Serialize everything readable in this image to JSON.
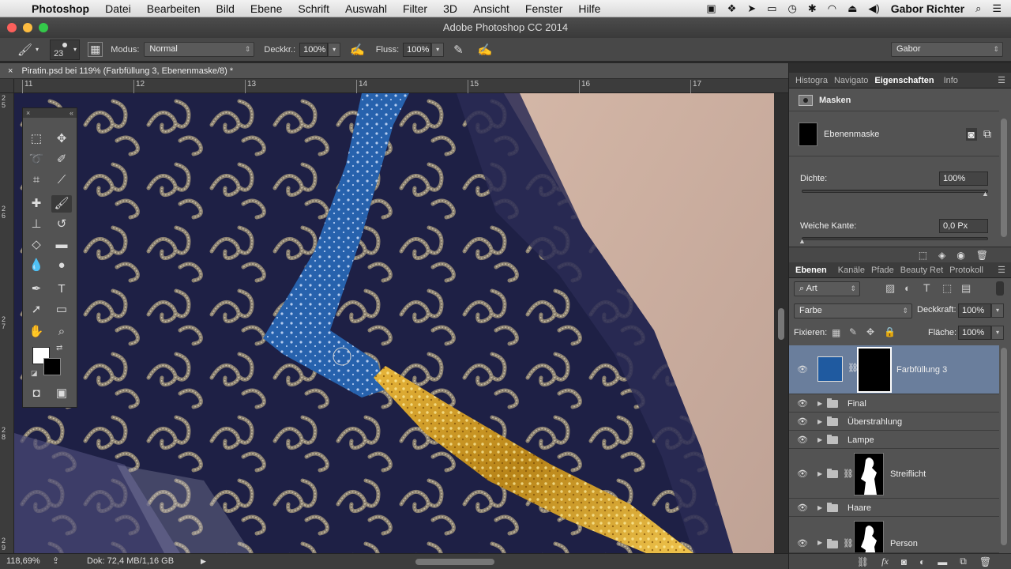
{
  "menubar": {
    "apple": "",
    "app": "Photoshop",
    "items": [
      "Datei",
      "Bearbeiten",
      "Bild",
      "Ebene",
      "Schrift",
      "Auswahl",
      "Filter",
      "3D",
      "Ansicht",
      "Fenster",
      "Hilfe"
    ],
    "user": "Gabor Richter"
  },
  "window": {
    "title": "Adobe Photoshop CC 2014"
  },
  "options": {
    "brush_size": "23",
    "modus_label": "Modus:",
    "modus_value": "Normal",
    "deckkr_label": "Deckkr.:",
    "deckkr_value": "100%",
    "fluss_label": "Fluss:",
    "fluss_value": "100%",
    "workspace": "Gabor"
  },
  "document": {
    "tab_title": "Piratin.psd bei 119% (Farbfüllung 3, Ebenenmaske/8) *",
    "ruler_h": [
      "11",
      "12",
      "13",
      "14",
      "15",
      "16",
      "17"
    ],
    "ruler_v": [
      "2\n5",
      "2\n6",
      "2\n7",
      "2\n8",
      "2\n9"
    ],
    "zoom": "118,69%",
    "doc_info": "Dok: 72,4 MB/1,16 GB"
  },
  "properties_panel": {
    "tabs": [
      "Histogra",
      "Navigato",
      "Eigenschaften",
      "Info"
    ],
    "active_tab": "Eigenschaften",
    "section": "Masken",
    "mask_name": "Ebenenmaske",
    "dichte_label": "Dichte:",
    "dichte_value": "100%",
    "weiche_label": "Weiche Kante:",
    "weiche_value": "0,0 Px"
  },
  "layers_panel": {
    "tabs": [
      "Ebenen",
      "Kanäle",
      "Pfade",
      "Beauty Ret",
      "Protokoll"
    ],
    "active_tab": "Ebenen",
    "filter_value": "Art",
    "blend_mode": "Farbe",
    "deckkraft_label": "Deckkraft:",
    "deckkraft_value": "100%",
    "fixieren_label": "Fixieren:",
    "flaeche_label": "Fläche:",
    "flaeche_value": "100%",
    "layers": [
      {
        "name": "Farbfüllung 3",
        "type": "fill",
        "selected": true
      },
      {
        "name": "Final",
        "type": "group"
      },
      {
        "name": "Überstrahlung",
        "type": "group"
      },
      {
        "name": "Lampe",
        "type": "group"
      },
      {
        "name": "Streiflicht",
        "type": "group-mask"
      },
      {
        "name": "Haare",
        "type": "group"
      },
      {
        "name": "Person",
        "type": "group-mask"
      }
    ]
  },
  "colors": {
    "accent_selected": "#6a7e9c",
    "fill_color": "#1f5aa0"
  }
}
